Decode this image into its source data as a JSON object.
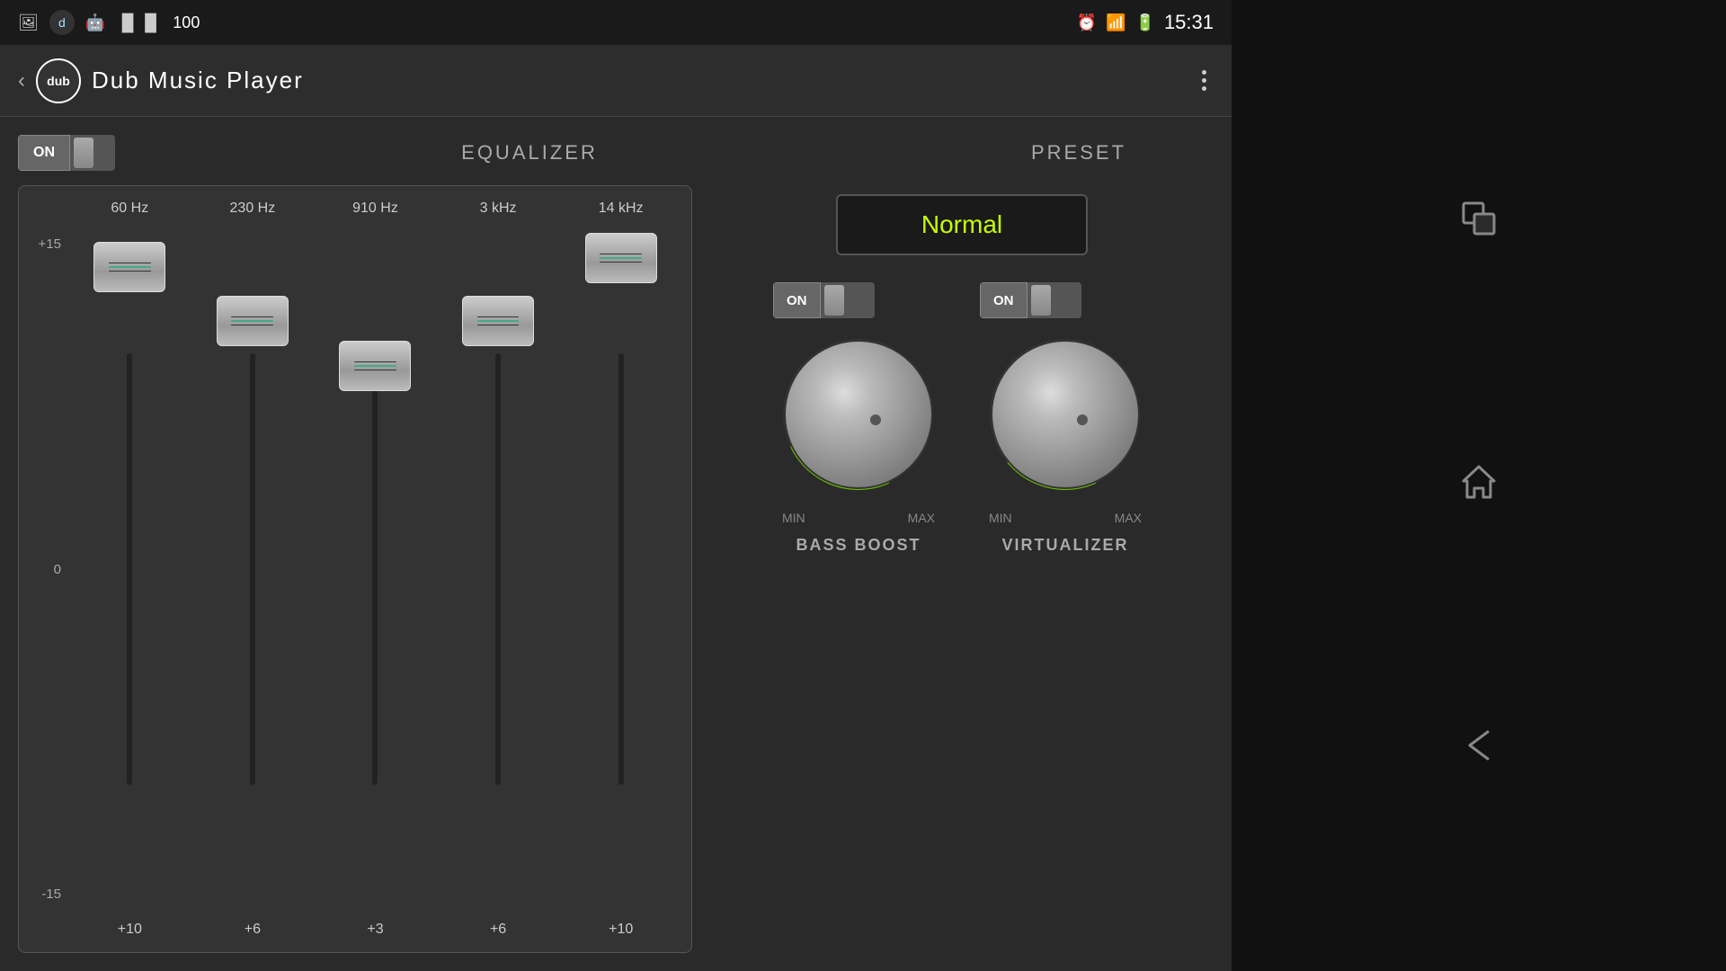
{
  "statusBar": {
    "time": "15:31",
    "icons": [
      "photo",
      "dub",
      "android",
      "barcode",
      "100"
    ]
  },
  "topBar": {
    "appLogo": "dub",
    "appTitle": "Dub  Music  Player",
    "menuLabel": "⋮"
  },
  "equalizer": {
    "onLabel": "ON",
    "title": "EQUALIZER",
    "presetTitle": "PRESET",
    "presetValue": "Normal",
    "bands": [
      {
        "freq": "60 Hz",
        "value": "+10",
        "sliderPos": 15
      },
      {
        "freq": "230 Hz",
        "value": "+6",
        "sliderPos": 30
      },
      {
        "freq": "910 Hz",
        "value": "+3",
        "sliderPos": 42
      },
      {
        "freq": "3 kHz",
        "value": "+6",
        "sliderPos": 30
      },
      {
        "freq": "14 kHz",
        "value": "+10",
        "sliderPos": 12
      }
    ],
    "scaleLabels": [
      "+15",
      "0",
      "-15"
    ]
  },
  "bassBoost": {
    "onLabel": "ON",
    "name": "BASS BOOST",
    "minLabel": "MIN",
    "maxLabel": "MAX"
  },
  "virtualizer": {
    "onLabel": "ON",
    "name": "VIRTUALIZER",
    "minLabel": "MIN",
    "maxLabel": "MAX"
  }
}
